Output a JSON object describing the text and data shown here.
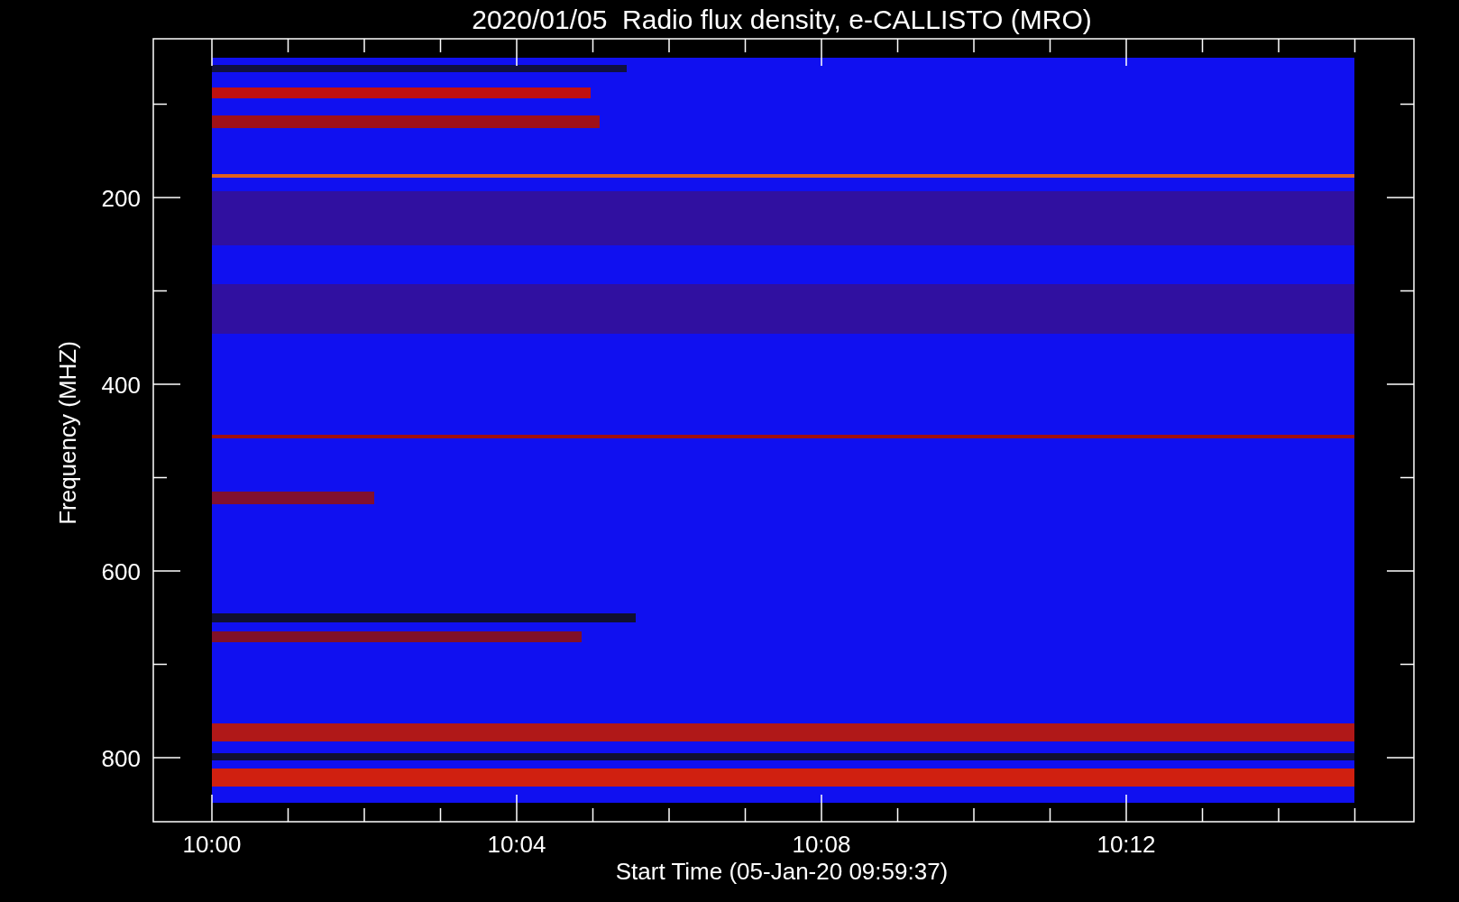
{
  "title": "2020/01/05  Radio flux density, e-CALLISTO (MRO)",
  "y_axis": {
    "label": "Frequency (MHZ)",
    "ticks": [
      "200",
      "400",
      "600",
      "800"
    ]
  },
  "x_axis": {
    "label": "Start Time (05-Jan-20 09:59:37)",
    "ticks": [
      "10:00",
      "10:04",
      "10:08",
      "10:12"
    ]
  }
}
